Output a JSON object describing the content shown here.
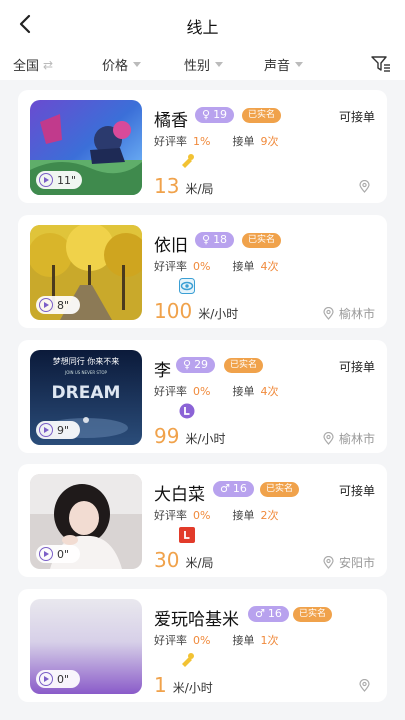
{
  "header": {
    "title": "线上"
  },
  "filters": [
    {
      "label": "全国",
      "icon": "swap-arrows-icon"
    },
    {
      "label": "价格",
      "icon": "chevron-down-icon"
    },
    {
      "label": "性别",
      "icon": "chevron-down-icon"
    },
    {
      "label": "声音",
      "icon": "chevron-down-icon"
    }
  ],
  "labels": {
    "rating": "好评率",
    "orders": "接单"
  },
  "colors": {
    "accent": "#f0a24b",
    "gender_badge": "#b8a2ee",
    "verified_badge": "#f0a24b",
    "play": "#7b5fc7"
  },
  "cards": [
    {
      "name": "橘香",
      "gender_symbol": "♀",
      "age": "19",
      "verified": "已实名",
      "status": "可接单",
      "rating": "1%",
      "orders": "9次",
      "skill_icon": "game-badge-yellow-icon",
      "price": "13",
      "unit": "米/局",
      "duration": "11\"",
      "location": ""
    },
    {
      "name": "依旧",
      "gender_symbol": "♀",
      "age": "18",
      "verified": "已实名",
      "status": "",
      "rating": "0%",
      "orders": "4次",
      "skill_icon": "eye-badge-icon",
      "price": "100",
      "unit": "米/小时",
      "duration": "8\"",
      "location": "榆林市"
    },
    {
      "name": "李",
      "gender_symbol": "♀",
      "age": "29",
      "verified": "已实名",
      "status": "可接单",
      "rating": "0%",
      "orders": "4次",
      "skill_icon": "purple-l-badge-icon",
      "price": "99",
      "unit": "米/小时",
      "duration": "9\"",
      "location": "榆林市"
    },
    {
      "name": "大白菜",
      "gender_symbol": "♂",
      "age": "16",
      "verified": "已实名",
      "status": "可接单",
      "rating": "0%",
      "orders": "2次",
      "skill_icon": "red-l-badge-icon",
      "price": "30",
      "unit": "米/局",
      "duration": "0\"",
      "location": "安阳市"
    },
    {
      "name": "爱玩哈基米",
      "gender_symbol": "♂",
      "age": "16",
      "verified": "已实名",
      "status": "",
      "rating": "0%",
      "orders": "1次",
      "skill_icon": "game-badge-yellow-icon",
      "price": "1",
      "unit": "米/小时",
      "duration": "0\"",
      "location": ""
    }
  ],
  "thumb_text": {
    "line1": "梦想同行 你来不来",
    "line2": "JOIN US NEVER STOP",
    "big": "DREAM"
  }
}
